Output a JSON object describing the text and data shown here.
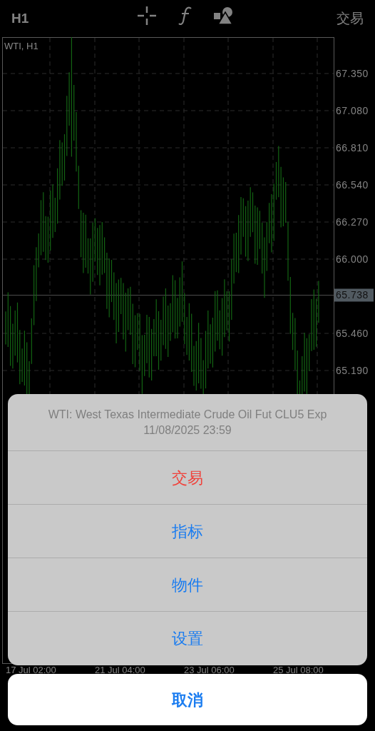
{
  "toolbar": {
    "timeframe": "H1",
    "trade_link": "交易"
  },
  "chart": {
    "title": "WTI, H1",
    "price_labels": [
      "67.350",
      "67.080",
      "66.810",
      "66.540",
      "66.270",
      "66.000",
      "65.460",
      "65.190"
    ],
    "current_price": "65.738",
    "time_labels": [
      "17 Jul 02:00",
      "21 Jul 04:00",
      "23 Jul 06:00",
      "25 Jul 08:00"
    ]
  },
  "action_sheet": {
    "title": "WTI: West Texas Intermediate Crude Oil Fut CLU5 Exp 11/08/2025 23:59",
    "items": [
      {
        "label": "交易",
        "kind": "destructive"
      },
      {
        "label": "指标",
        "kind": "default"
      },
      {
        "label": "物件",
        "kind": "default"
      },
      {
        "label": "设置",
        "kind": "default"
      }
    ],
    "cancel": "取消"
  }
}
